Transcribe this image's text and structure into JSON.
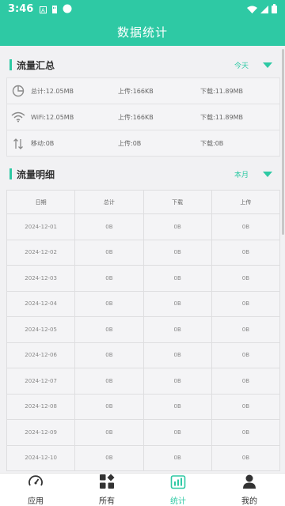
{
  "status_bar": {
    "time": "3:46"
  },
  "app_bar": {
    "title": "数据统计"
  },
  "summary_section": {
    "label": "流量汇总",
    "filter": "今天",
    "rows": [
      {
        "icon": "pie-chart-icon",
        "total": "总计:12.05MB",
        "upload": "上传:166KB",
        "download": "下载:11.89MB"
      },
      {
        "icon": "wifi-icon",
        "total": "WiFi:12.05MB",
        "upload": "上传:166KB",
        "download": "下载:11.89MB"
      },
      {
        "icon": "mobile-data-icon",
        "total": "移动:0B",
        "upload": "上传:0B",
        "download": "下载:0B"
      }
    ]
  },
  "detail_section": {
    "label": "流量明细",
    "filter": "本月",
    "columns": [
      "日期",
      "总计",
      "下载",
      "上传"
    ],
    "rows": [
      [
        "2024-12-01",
        "0B",
        "0B",
        "0B"
      ],
      [
        "2024-12-02",
        "0B",
        "0B",
        "0B"
      ],
      [
        "2024-12-03",
        "0B",
        "0B",
        "0B"
      ],
      [
        "2024-12-04",
        "0B",
        "0B",
        "0B"
      ],
      [
        "2024-12-05",
        "0B",
        "0B",
        "0B"
      ],
      [
        "2024-12-06",
        "0B",
        "0B",
        "0B"
      ],
      [
        "2024-12-07",
        "0B",
        "0B",
        "0B"
      ],
      [
        "2024-12-08",
        "0B",
        "0B",
        "0B"
      ],
      [
        "2024-12-09",
        "0B",
        "0B",
        "0B"
      ],
      [
        "2024-12-10",
        "0B",
        "0B",
        "0B"
      ]
    ]
  },
  "bottom_nav": [
    {
      "label": "应用",
      "icon": "speedometer-icon",
      "active": false
    },
    {
      "label": "所有",
      "icon": "grid-icon",
      "active": false
    },
    {
      "label": "统计",
      "icon": "stats-icon",
      "active": true
    },
    {
      "label": "我的",
      "icon": "person-icon",
      "active": false
    }
  ],
  "colors": {
    "accent": "#2ec9a4"
  }
}
